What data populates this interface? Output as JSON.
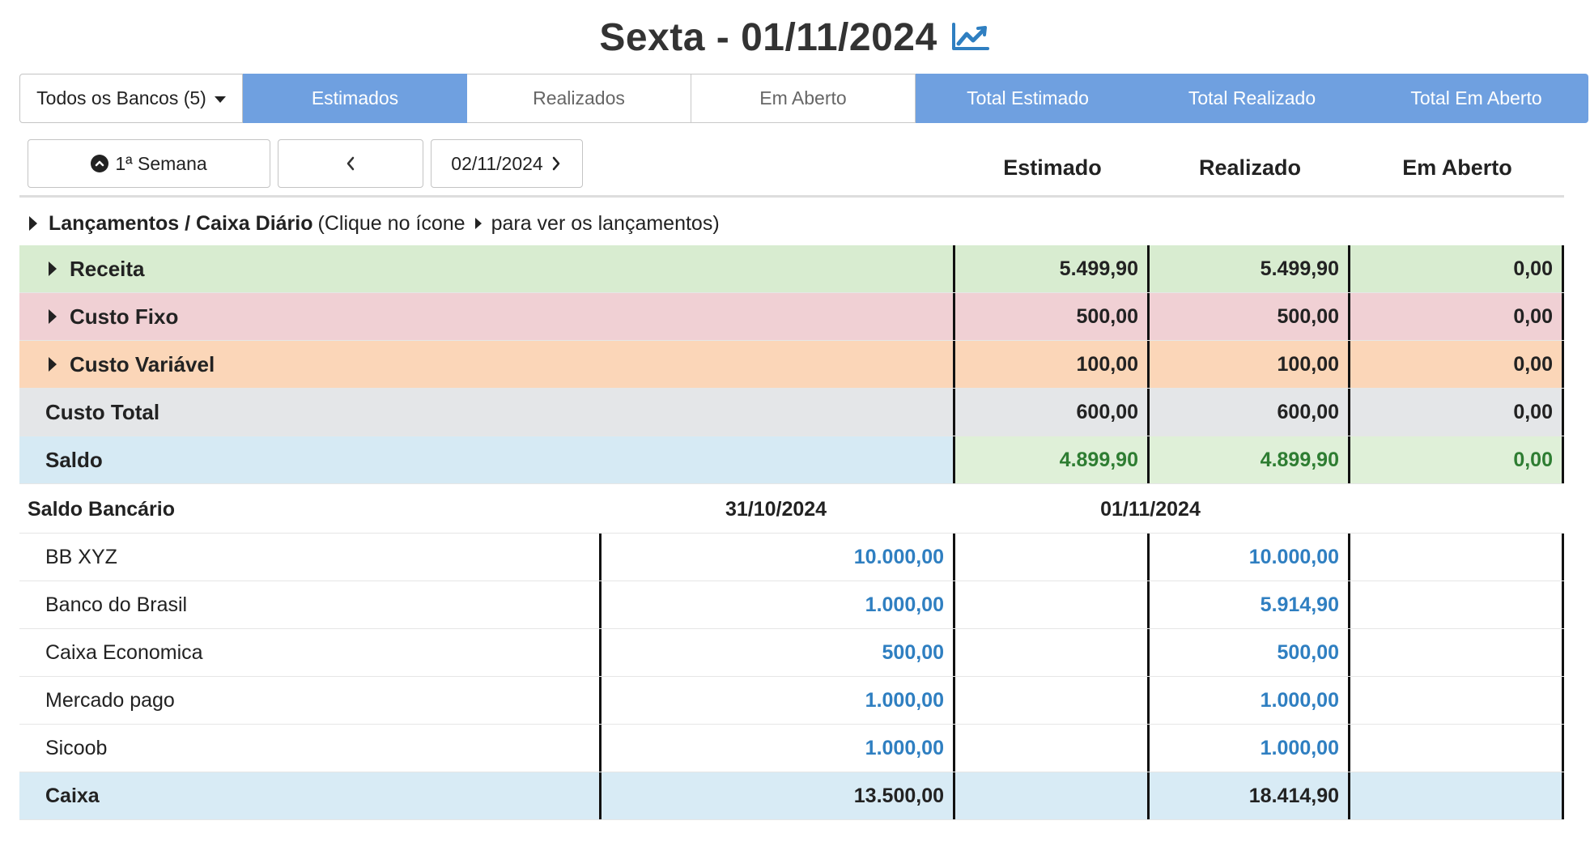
{
  "header": {
    "title": "Sexta - 01/11/2024",
    "chart_icon": "chart-line-icon",
    "accent_color": "#2f7fc1"
  },
  "tabs": {
    "bank_select": "Todos os Bancos (5)",
    "items": [
      {
        "label": "Estimados"
      },
      {
        "label": "Realizados"
      },
      {
        "label": "Em Aberto"
      },
      {
        "label": "Total Estimado"
      },
      {
        "label": "Total Realizado"
      },
      {
        "label": "Total Em Aberto"
      }
    ],
    "active_color": "#6fa0e0"
  },
  "controls": {
    "week_label": "1ª Semana",
    "next_date": "02/11/2024"
  },
  "columns": {
    "estimado": "Estimado",
    "realizado": "Realizado",
    "em_aberto": "Em Aberto"
  },
  "section": {
    "title": "Lançamentos / Caixa Diário",
    "hint_before": "(Clique no ícone",
    "hint_after": "para ver os lançamentos)"
  },
  "cash_rows": [
    {
      "label": "Receita",
      "estimado": "5.499,90",
      "realizado": "5.499,90",
      "em_aberto": "0,00",
      "color": "#d8ecd0"
    },
    {
      "label": "Custo Fixo",
      "estimado": "500,00",
      "realizado": "500,00",
      "em_aberto": "0,00",
      "color": "#f0d0d4"
    },
    {
      "label": "Custo Variável",
      "estimado": "100,00",
      "realizado": "100,00",
      "em_aberto": "0,00",
      "color": "#fbd6b8"
    },
    {
      "label": "Custo Total",
      "estimado": "600,00",
      "realizado": "600,00",
      "em_aberto": "0,00",
      "color": "#e4e6e8"
    },
    {
      "label": "Saldo",
      "estimado": "4.899,90",
      "realizado": "4.899,90",
      "em_aberto": "0,00",
      "color": "#2e7d32"
    }
  ],
  "bank_balance": {
    "title": "Saldo Bancário",
    "date_prev": "31/10/2024",
    "date_curr": "01/11/2024",
    "rows": [
      {
        "label": "BB XYZ",
        "prev": "10.000,00",
        "curr": "10.000,00"
      },
      {
        "label": "Banco do Brasil",
        "prev": "1.000,00",
        "curr": "5.914,90"
      },
      {
        "label": "Caixa Economica",
        "prev": "500,00",
        "curr": "500,00"
      },
      {
        "label": "Mercado pago",
        "prev": "1.000,00",
        "curr": "1.000,00"
      },
      {
        "label": "Sicoob",
        "prev": "1.000,00",
        "curr": "1.000,00"
      }
    ],
    "total": {
      "label": "Caixa",
      "prev": "13.500,00",
      "curr": "18.414,90"
    }
  }
}
